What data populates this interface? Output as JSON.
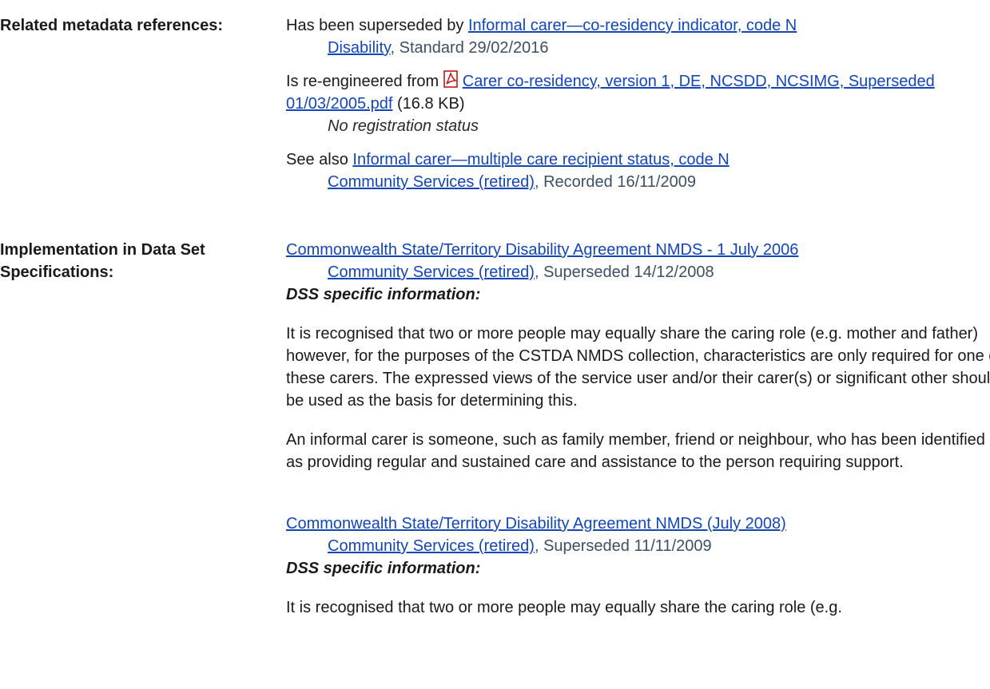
{
  "related": {
    "label": "Related metadata references:",
    "superseded_prefix": "Has been superseded by ",
    "superseded_link": "Informal carer—co-residency indicator, code N",
    "superseded_reg_link": "Disability",
    "superseded_reg_text": ", Standard 29/02/2016",
    "reengineered_prefix": "Is re-engineered from ",
    "reengineered_link": "Carer co-residency, version 1, DE, NCSDD, NCSIMG, Superseded 01/03/2005.pdf",
    "reengineered_size": " (16.8 KB)",
    "reengineered_status": "No registration status",
    "see_also_prefix": "See also ",
    "see_also_link": "Informal carer—multiple care recipient status, code N",
    "see_also_reg_link": "Community Services (retired)",
    "see_also_reg_text": ", Recorded 16/11/2009"
  },
  "implementation": {
    "label": "Implementation in Data Set Specifications:",
    "entries": [
      {
        "link": "Commonwealth State/Territory Disability Agreement NMDS - 1 July 2006",
        "reg_link": "Community Services (retired)",
        "reg_text": ", Superseded 14/12/2008",
        "dss_label": "DSS specific information:",
        "para1": "It is recognised that two or more people may equally share the caring role (e.g. mother and father) however, for the purposes of the CSTDA NMDS collection, characteristics are only required for one of these carers. The expressed views of the service user and/or their carer(s) or significant other should be used as the basis for determining this.",
        "para2": "An informal carer is someone, such as family member, friend or neighbour, who has been identified as providing regular and sustained care and assistance to the person requiring support."
      },
      {
        "link": "Commonwealth State/Territory Disability Agreement NMDS (July 2008)",
        "reg_link": "Community Services (retired)",
        "reg_text": ", Superseded 11/11/2009",
        "dss_label": "DSS specific information:",
        "para1": "It is recognised that two or more people may equally share the caring role (e.g."
      }
    ]
  },
  "colors": {
    "link": "#1346b8",
    "registration": "#3c4f63"
  }
}
